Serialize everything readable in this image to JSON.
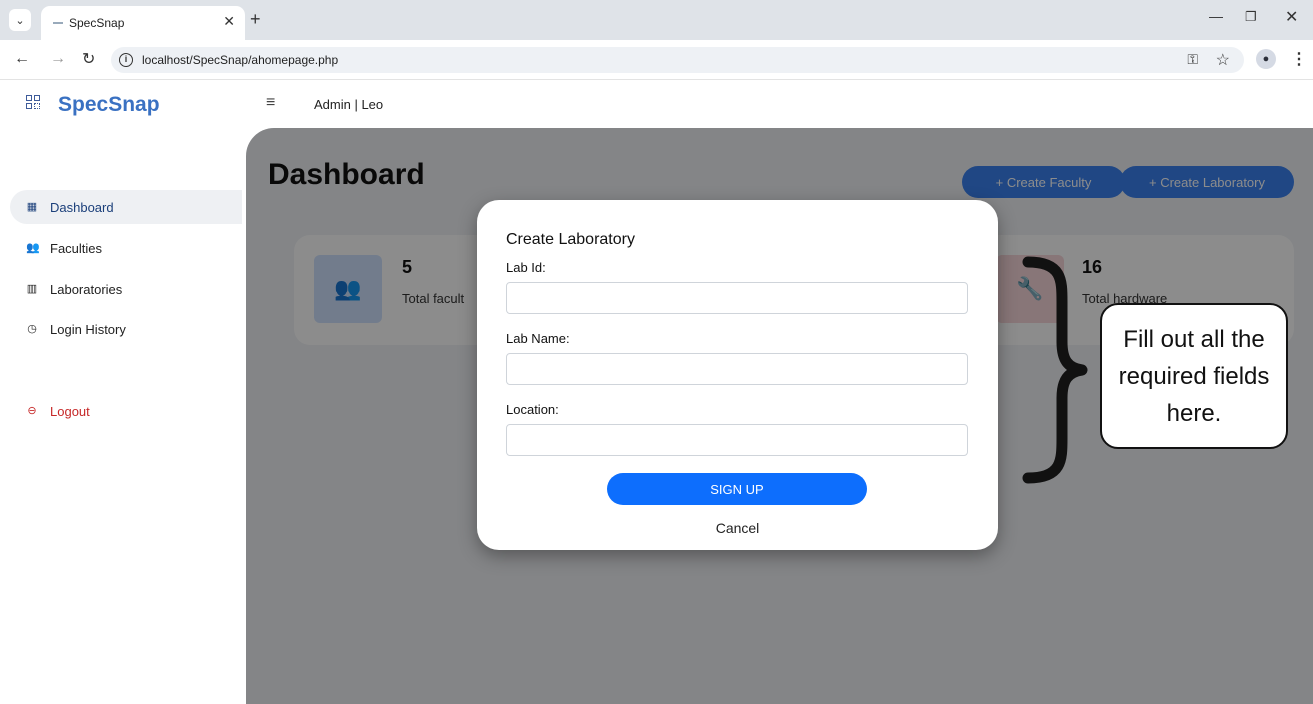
{
  "browser": {
    "tab_title": "SpecSnap",
    "url": "localhost/SpecSnap/ahomepage.php",
    "icons": [
      "chevron-down-icon",
      "close-icon",
      "plus-icon",
      "back-icon",
      "forward-icon",
      "reload-icon",
      "info-icon",
      "key-icon",
      "star-icon",
      "profile-icon",
      "kebab-icon"
    ]
  },
  "header": {
    "brand": "SpecSnap",
    "user_label": "Admin | Leo"
  },
  "sidebar": {
    "items": [
      {
        "label": "Dashboard",
        "icon": "grid-icon",
        "active": true
      },
      {
        "label": "Faculties",
        "icon": "users-icon"
      },
      {
        "label": "Laboratories",
        "icon": "building-icon"
      },
      {
        "label": "Login History",
        "icon": "clock-icon"
      }
    ],
    "logout": {
      "label": "Logout",
      "icon": "logout-icon",
      "color": "#c62828"
    }
  },
  "main": {
    "title": "Dashboard",
    "buttons": {
      "create_faculty": "+  Create Faculty",
      "create_laboratory": "+  Create Laboratory"
    },
    "stats": [
      {
        "value": "5",
        "label": "Total facult",
        "icon": "users-icon"
      },
      {
        "value": "16",
        "label": "Total hardware",
        "icon": "wrench-icon"
      }
    ]
  },
  "modal": {
    "title": "Create Laboratory",
    "fields": [
      {
        "label": "Lab Id:",
        "value": ""
      },
      {
        "label": "Lab Name:",
        "value": ""
      },
      {
        "label": "Location:",
        "value": ""
      }
    ],
    "submit_label": "SIGN UP",
    "cancel_label": "Cancel"
  },
  "annotation": {
    "text": "Fill out all the required fields here."
  },
  "colors": {
    "brand": "#3a71c2",
    "primary_button": "#0d6efd",
    "header_button": "#3b82f0",
    "logout": "#c62828"
  }
}
